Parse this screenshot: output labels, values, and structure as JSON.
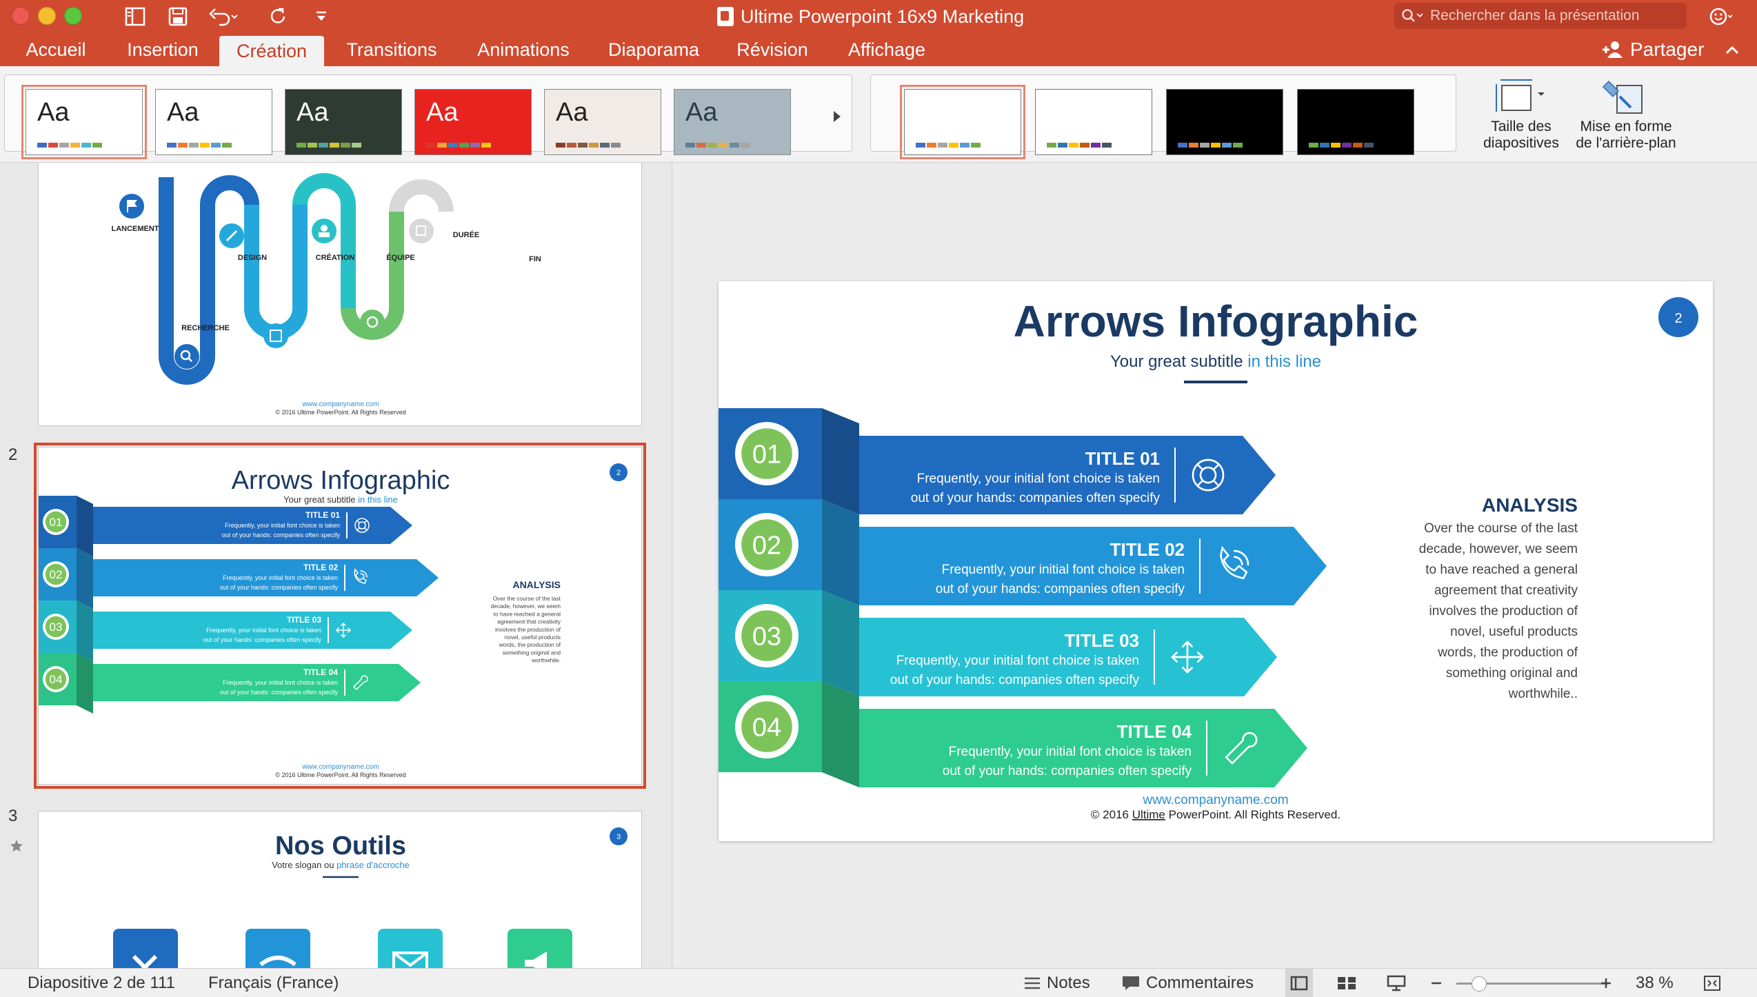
{
  "window": {
    "title": "Ultime Powerpoint 16x9 Marketing",
    "search_placeholder": "Rechercher dans la présentation"
  },
  "tabs": [
    {
      "label": "Accueil"
    },
    {
      "label": "Insertion"
    },
    {
      "label": "Création",
      "active": true
    },
    {
      "label": "Transitions"
    },
    {
      "label": "Animations"
    },
    {
      "label": "Diaporama"
    },
    {
      "label": "Révision"
    },
    {
      "label": "Affichage"
    }
  ],
  "share_label": "Partager",
  "themes": [
    {
      "label": "Aa",
      "bg": "#ffffff",
      "fg": "#222222",
      "colors": [
        "#3d6cc5",
        "#e0483a",
        "#a5a5a5",
        "#f2b33d",
        "#4bb8c8",
        "#70ad47"
      ]
    },
    {
      "label": "Aa",
      "bg": "#ffffff",
      "fg": "#222222",
      "colors": [
        "#4472c4",
        "#ed7d31",
        "#a5a5a5",
        "#ffc000",
        "#5b9bd5",
        "#70ad47"
      ]
    },
    {
      "label": "Aa",
      "bg": "#2e3b33",
      "fg": "#ffffff",
      "colors": [
        "#70ad47",
        "#a5c34f",
        "#56a098",
        "#d3c13a",
        "#7b9e4a",
        "#a3c98b"
      ]
    },
    {
      "label": "Aa",
      "bg": "#e8221f",
      "fg": "#ffffff",
      "colors": [
        "#e0332d",
        "#f2a33a",
        "#3a7fc1",
        "#59a14f",
        "#8c6bb1",
        "#f0c419"
      ]
    },
    {
      "label": "Aa",
      "bg": "#f0ebe6",
      "fg": "#222222",
      "colors": [
        "#8e3c2c",
        "#b85a3a",
        "#7a5b45",
        "#c99a3d",
        "#5b6b7a",
        "#8a8a8a"
      ]
    },
    {
      "label": "Aa",
      "bg": "#a9b8c0",
      "fg": "#2b3c46",
      "colors": [
        "#5b7f95",
        "#d96c3d",
        "#9db054",
        "#e3b04a",
        "#6e8c9a",
        "#a5a5a5"
      ]
    }
  ],
  "variants": [
    {
      "bg": "#ffffff",
      "colors": [
        "#4472c4",
        "#ed7d31",
        "#a5a5a5",
        "#ffc000",
        "#5b9bd5",
        "#70ad47"
      ]
    },
    {
      "bg": "#ffffff",
      "colors": [
        "#70ad47",
        "#2e75b6",
        "#ffc000",
        "#c55a11",
        "#7030a0",
        "#44546a"
      ]
    },
    {
      "bg": "#000000",
      "colors": [
        "#4472c4",
        "#ed7d31",
        "#a5a5a5",
        "#ffc000",
        "#5b9bd5",
        "#70ad47"
      ]
    },
    {
      "bg": "#000000",
      "colors": [
        "#70ad47",
        "#2e75b6",
        "#ffc000",
        "#7030a0",
        "#c55a11",
        "#44546a"
      ]
    }
  ],
  "ribbon_buttons": {
    "slide_size": "Taille des\ndiapositives",
    "format_background": "Mise en forme\nde l'arrière-plan"
  },
  "slides": {
    "slide1": {
      "steps": [
        "LANCEMENT",
        "RECHERCHE",
        "DESIGN",
        "CRÉATION",
        "ÉQUIPE",
        "DURÉE",
        "FIN"
      ],
      "footer_url": "www.companyname.com",
      "footer_copy": "© 2016 Ultime PowerPoint. All Rights Reserved"
    },
    "slide2": {
      "number": "2",
      "title": "Arrows Infographic",
      "subtitle_a": "Your great subtitle ",
      "subtitle_b": "in this line",
      "items": [
        {
          "num": "01",
          "title": "TITLE 01",
          "line1": "Frequently, your initial font choice is taken",
          "line2": "out of your hands: companies often specify",
          "icon": "lifebuoy-icon",
          "color": "#1f6bbf"
        },
        {
          "num": "02",
          "title": "TITLE 02",
          "line1": "Frequently, your initial font choice is taken",
          "line2": "out of your hands: companies often specify",
          "icon": "phone-icon",
          "color": "#2295d9"
        },
        {
          "num": "03",
          "title": "TITLE 03",
          "line1": "Frequently, your initial font choice is taken",
          "line2": "out of your hands: companies often specify",
          "icon": "move-arrows-icon",
          "color": "#27c1d4"
        },
        {
          "num": "04",
          "title": "TITLE 04",
          "line1": "Frequently, your initial font choice is taken",
          "line2": "out of your hands: companies often specify",
          "icon": "wrench-icon",
          "color": "#2ecc8f"
        }
      ],
      "analysis_title": "ANALYSIS",
      "analysis_lines_main": [
        "Over the course of the last",
        "decade, however, we seem",
        "to have reached a general",
        "agreement that creativity",
        "involves the production of",
        "novel, useful products",
        "words, the production of",
        "something original and",
        "worthwhile.."
      ],
      "analysis_lines_thumb": [
        "Over the course of the last",
        "decade, however, we seem",
        "to have reached a general",
        "agreement that creativity",
        "involves the production of",
        "novel, useful products",
        "words, the production of",
        "something original and",
        "worthwhile."
      ],
      "footer_url": "www.companyname.com",
      "footer_copy_a": "© 2016 ",
      "footer_copy_b": "Ultime",
      "footer_copy_c": " PowerPoint. All Rights Reserved.",
      "footer_copy_thumb": "© 2016 Ultime PowerPoint. All Rights Reserved"
    },
    "slide3": {
      "number": "3",
      "title": "Nos Outils",
      "subtitle_a": "Votre slogan ou ",
      "subtitle_b": "phrase d'accroche"
    }
  },
  "slide_numbers": [
    "2",
    "3"
  ],
  "colors": {
    "accent": "#d04a30",
    "navy": "#1b3a63",
    "blue": "#1f6bbf",
    "green_circle": "#7dc35a"
  },
  "status": {
    "slide_count": "Diapositive 2 de 111",
    "language": "Français (France)",
    "notes": "Notes",
    "comments": "Commentaires",
    "zoom": "38 %"
  }
}
